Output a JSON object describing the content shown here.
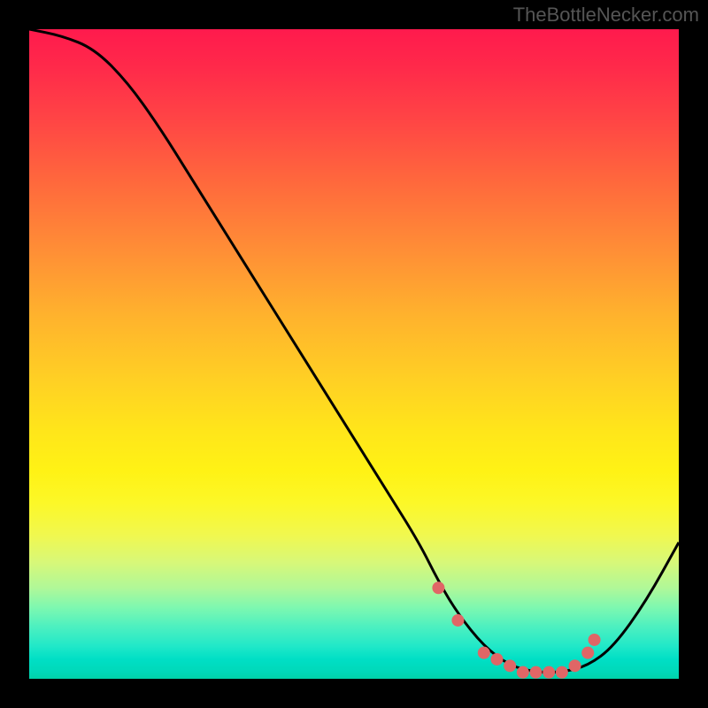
{
  "attribution": "TheBottleNecker.com",
  "chart_data": {
    "type": "line",
    "title": "",
    "xlabel": "",
    "ylabel": "",
    "xlim": [
      0,
      100
    ],
    "ylim": [
      0,
      100
    ],
    "series": [
      {
        "name": "bottleneck-curve",
        "x": [
          0,
          5,
          10,
          15,
          20,
          25,
          30,
          35,
          40,
          45,
          50,
          55,
          60,
          63,
          66,
          70,
          74,
          78,
          82,
          86,
          90,
          95,
          100
        ],
        "values": [
          100,
          99,
          97,
          92,
          85,
          77,
          69,
          61,
          53,
          45,
          37,
          29,
          21,
          15,
          10,
          5,
          2,
          1,
          1,
          2,
          5,
          12,
          21
        ]
      }
    ],
    "markers": {
      "name": "flat-region-dots",
      "x": [
        63,
        66,
        70,
        72,
        74,
        76,
        78,
        80,
        82,
        84,
        86,
        87
      ],
      "values": [
        14,
        9,
        4,
        3,
        2,
        1,
        1,
        1,
        1,
        2,
        4,
        6
      ],
      "color": "#e06666"
    },
    "background_gradient": {
      "stops": [
        {
          "pos": 0,
          "color": "#ff1a4d"
        },
        {
          "pos": 50,
          "color": "#ffd024"
        },
        {
          "pos": 75,
          "color": "#f0f850"
        },
        {
          "pos": 100,
          "color": "#00d2a8"
        }
      ]
    }
  }
}
